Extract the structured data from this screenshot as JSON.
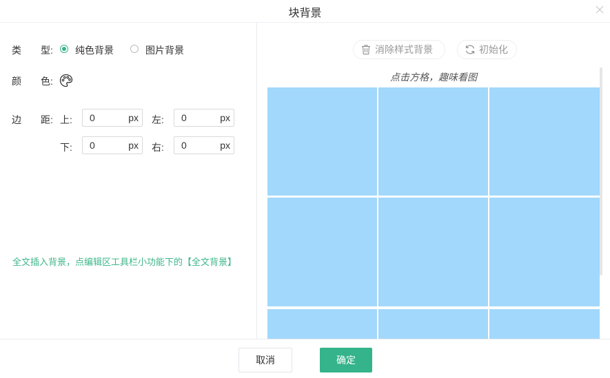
{
  "dialog": {
    "title": "块背景"
  },
  "type_row": {
    "label_a": "类",
    "label_b": "型:",
    "options": [
      {
        "label": "纯色背景",
        "checked": true
      },
      {
        "label": "图片背景",
        "checked": false
      }
    ]
  },
  "color_row": {
    "label_a": "颜",
    "label_b": "色:",
    "icon": "palette-icon"
  },
  "margin_row": {
    "label_a": "边",
    "label_b": "距:",
    "fields": {
      "top": {
        "label": "上:",
        "value": "0",
        "unit": "px"
      },
      "left": {
        "label": "左:",
        "value": "0",
        "unit": "px"
      },
      "bottom": {
        "label": "下:",
        "value": "0",
        "unit": "px"
      },
      "right": {
        "label": "右:",
        "value": "0",
        "unit": "px"
      }
    }
  },
  "tip": "全文插入背景，点编辑区工具栏小功能下的【全文背景】",
  "preview": {
    "clear_button": "消除样式背景",
    "clear_icon": "trash-icon",
    "reset_button": "初始化",
    "reset_icon": "refresh-icon",
    "hint": "点击方格，趣味看图",
    "cell_color": "#a2d8fb"
  },
  "footer": {
    "cancel": "取消",
    "ok": "确定",
    "ok_color": "#35b38a"
  }
}
